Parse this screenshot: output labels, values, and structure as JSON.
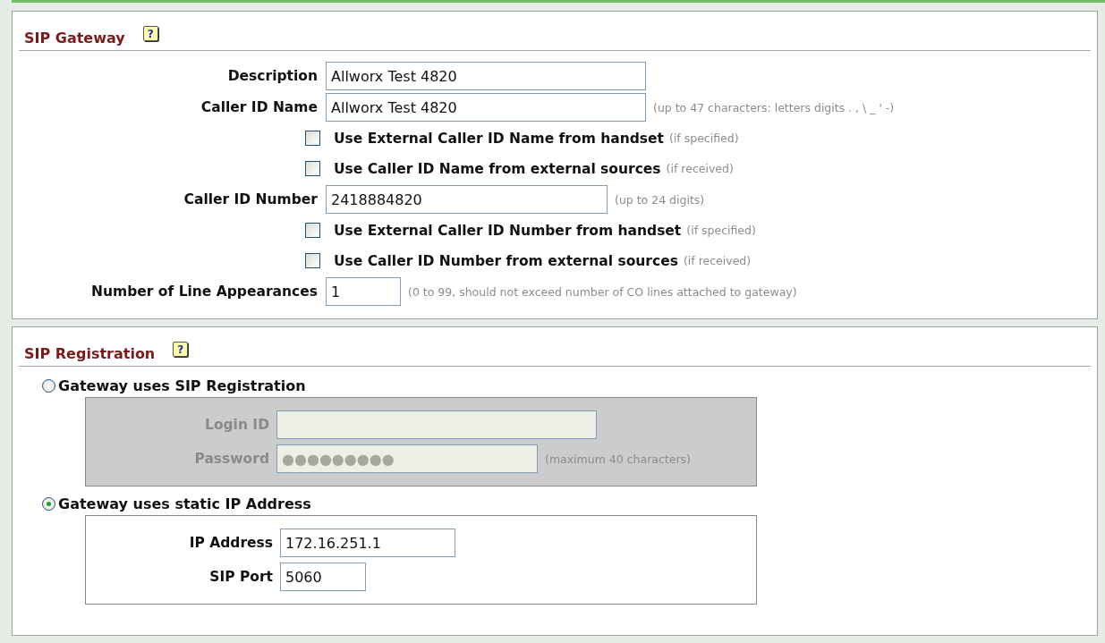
{
  "gateway": {
    "title": "SIP Gateway",
    "help": "?",
    "rows": [
      {
        "kind": "field",
        "label": "Description",
        "value": "Allworx Test 4820"
      },
      {
        "kind": "field",
        "label": "Caller ID Name",
        "value": "Allworx Test 4820",
        "hint": "(up to 47 characters: letters digits . , \\ _ ' -)"
      },
      {
        "kind": "check",
        "label": "Use External Caller ID Name from handset",
        "hint": "(if specified)",
        "checked": false
      },
      {
        "kind": "check",
        "label": "Use Caller ID Name from external sources",
        "hint": "(if received)",
        "checked": false
      },
      {
        "kind": "field",
        "label": "Caller ID Number",
        "value": "2418884820",
        "hint": "(up to 24 digits)"
      },
      {
        "kind": "check",
        "label": "Use External Caller ID Number from handset",
        "hint": "(if specified)",
        "checked": false
      },
      {
        "kind": "check",
        "label": "Use Caller ID Number from external sources",
        "hint": "(if received)",
        "checked": false
      },
      {
        "kind": "field",
        "label": "Number of Line Appearances",
        "value": "1",
        "hint": "(0 to 99, should not exceed number of CO lines attached to gateway)"
      }
    ]
  },
  "registration": {
    "title": "SIP Registration",
    "help": "?",
    "options": [
      {
        "label": "Gateway uses SIP Registration",
        "selected": false,
        "fields": [
          {
            "label": "Login ID"
          },
          {
            "label": "Password",
            "value": "●●●●●●●●●",
            "hint": "(maximum 40 characters)"
          }
        ]
      },
      {
        "label": "Gateway uses static IP Address",
        "selected": true,
        "fields": [
          {
            "label": "IP Address",
            "value": "172.16.251.1"
          },
          {
            "label": "SIP Port",
            "value": "5060"
          }
        ]
      }
    ]
  }
}
